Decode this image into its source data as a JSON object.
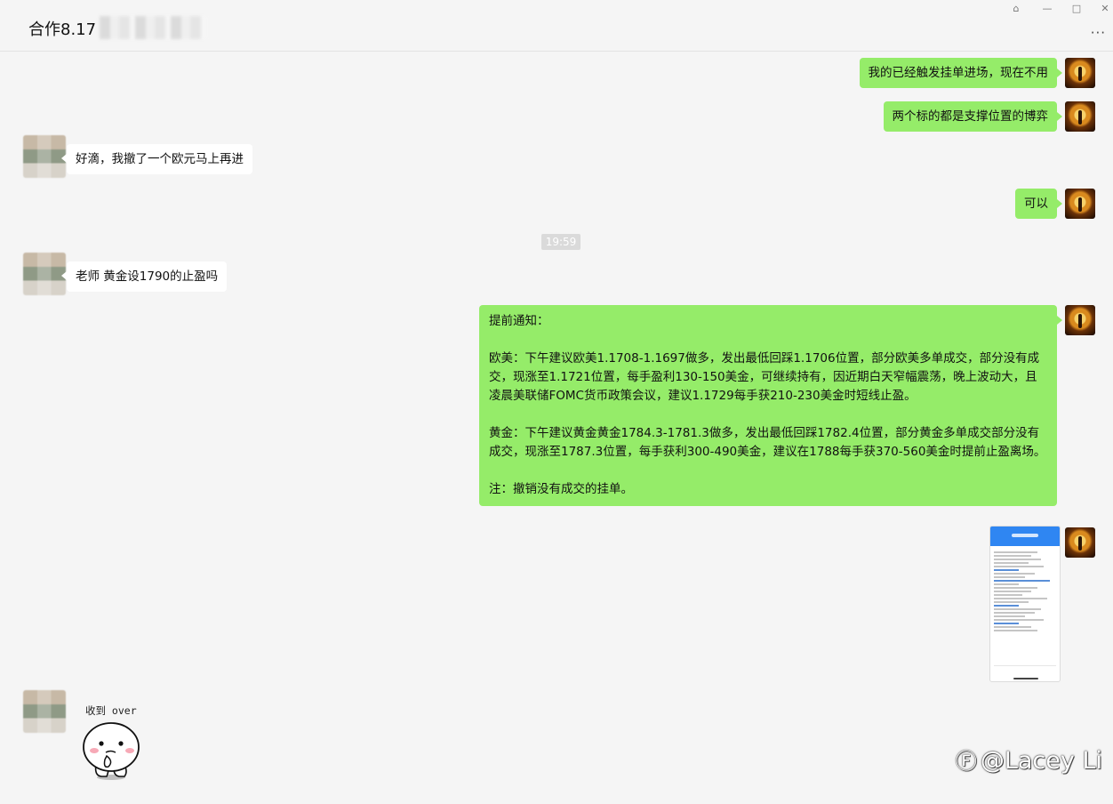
{
  "window": {
    "title": "合作8.17",
    "pin_icon": "pin-icon",
    "minimize_icon": "minimize-icon",
    "maximize_icon": "maximize-icon",
    "more_icon": "more-dots-icon",
    "more_label": "···"
  },
  "messages": [
    {
      "from": "me",
      "text": "我的已经触发挂单进场，现在不用"
    },
    {
      "from": "me",
      "text": "两个标的都是支撑位置的博弈"
    },
    {
      "from": "other",
      "text": "好滴，我撤了一个欧元马上再进"
    },
    {
      "from": "me",
      "text": "可以"
    },
    {
      "type": "timestamp",
      "text": "19:59"
    },
    {
      "from": "other",
      "text": "老师 黄金设1790的止盈吗"
    },
    {
      "from": "me",
      "long": true,
      "lines": [
        "提前通知：",
        "",
        "欧美：下午建议欧美1.1708-1.1697做多，发出最低回踩1.1706位置，部分欧美多单成交，部分没有成交，现涨至1.1721位置，每手盈利130-150美金，可继续持有，因近期白天窄幅震荡，晚上波动大，且凌晨美联储FOMC货币政策会议，建议1.1729每手获210-230美金时短线止盈。",
        "",
        "黄金：下午建议黄金黄金1784.3-1781.3做多，发出最低回踩1782.4位置，部分黄金多单成交部分没有成交，现涨至1787.3位置，每手获利300-490美金，建议在1788每手获370-560美金时提前止盈离场。",
        "",
        "注：撤销没有成交的挂单。"
      ]
    },
    {
      "from": "me",
      "type": "image"
    },
    {
      "from": "other",
      "type": "sticker",
      "text": "收到 over"
    }
  ],
  "watermark": {
    "text": "@Lacey Li",
    "icon": "weibo-logo-icon"
  },
  "colors": {
    "bubble_me": "#95ec69",
    "bubble_other": "#ffffff",
    "background": "#f5f5f5"
  }
}
